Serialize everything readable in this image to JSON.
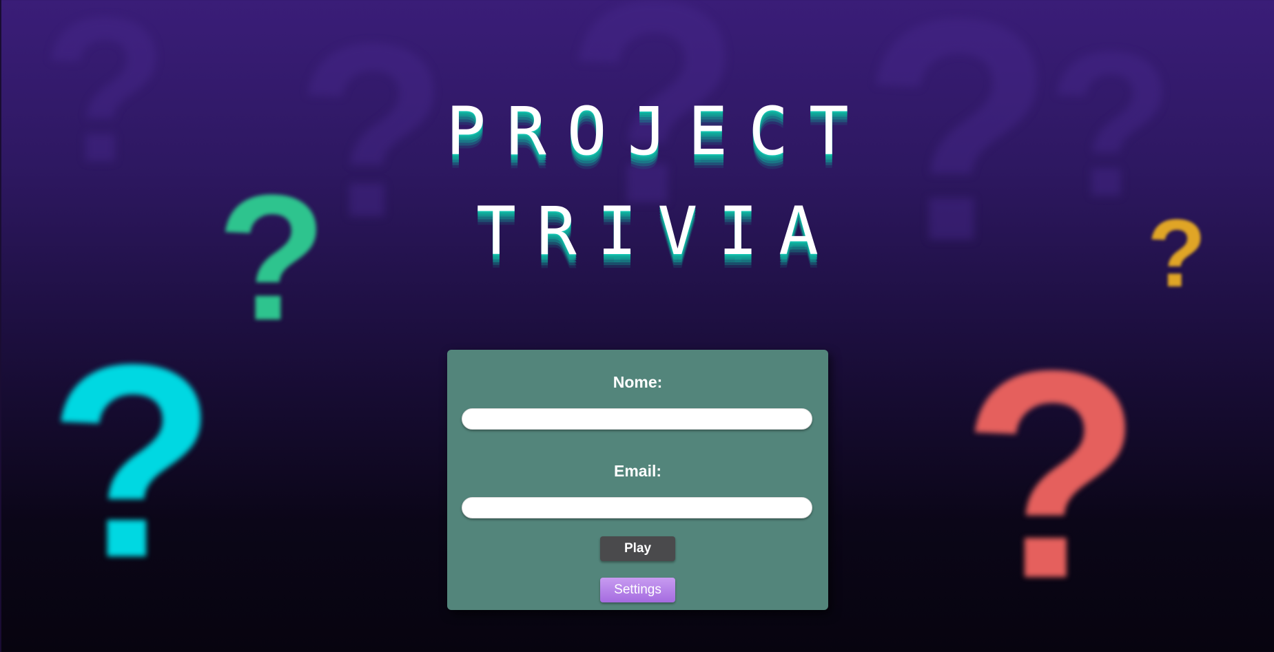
{
  "title": {
    "line1": "PROJECT",
    "line2": "TRIVIA"
  },
  "decorations": {
    "glyph": "?",
    "colors": {
      "green": "#2ec48e",
      "cyan": "#00d8e2",
      "orange": "#e0a526",
      "red": "#e5605d"
    }
  },
  "form": {
    "name_label": "Nome:",
    "name_value": "",
    "email_label": "Email:",
    "email_value": "",
    "play_label": "Play",
    "settings_label": "Settings"
  },
  "colors": {
    "card_background": "#53857b",
    "play_button": "#4a4a4c",
    "settings_button": "#b283e8",
    "title_shadow": "#15c3b0"
  }
}
